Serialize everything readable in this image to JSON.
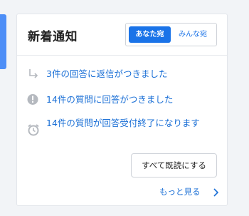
{
  "card": {
    "title": "新着通知",
    "tabs": [
      {
        "label": "あなた宛",
        "active": true
      },
      {
        "label": "みんな宛",
        "active": false
      }
    ]
  },
  "notifications": [
    {
      "icon": "reply-arrow-icon",
      "text": "3件の回答に返信がつきました"
    },
    {
      "icon": "exclamation-circle-icon",
      "text": "14件の質問に回答がつきました"
    },
    {
      "icon": "alarm-clock-icon",
      "text": "14件の質問が回答受付終了になります"
    }
  ],
  "actions": {
    "mark_all_read": "すべて既読にする",
    "see_more": "もっと見る"
  },
  "colors": {
    "accent": "#1a73e8",
    "link": "#1a6fd6",
    "icon_gray": "#b5b9bf"
  }
}
